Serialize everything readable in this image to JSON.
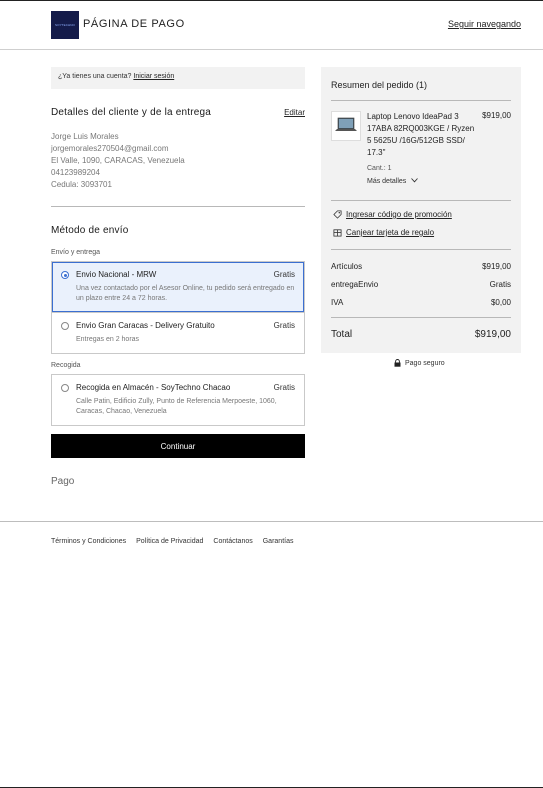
{
  "header": {
    "logo_text": "SOYTECHNO",
    "title": "PÁGINA DE PAGO",
    "continue_shopping": "Seguir navegando"
  },
  "login": {
    "question": "¿Ya tienes una cuenta?",
    "link": "Iniciar sesión"
  },
  "customer": {
    "title": "Detalles del cliente y de la entrega",
    "edit": "Editar",
    "name": "Jorge Luis Morales",
    "email": "jorgemorales270504@gmail.com",
    "address": "El Valle, 1090, CARACAS, Venezuela",
    "phone": "04123989204",
    "cedula": "Cedula: 3093701"
  },
  "shipping": {
    "title": "Método de envío",
    "delivery_label": "Envío y entrega",
    "options": [
      {
        "name": "Envio Nacional - MRW",
        "price": "Gratis",
        "desc": "Una vez contactado por el Asesor Online, tu pedido será entregado en un plazo entre 24 a 72 horas.",
        "selected": true
      },
      {
        "name": "Envio Gran Caracas - Delivery Gratuito",
        "price": "Gratis",
        "desc": "Entregas en 2 horas",
        "selected": false
      }
    ],
    "pickup_label": "Recogida",
    "pickup": {
      "name": "Recogida en Almacén - SoyTechno Chacao",
      "price": "Gratis",
      "desc": "Calle Patin, Edificio Zully, Punto de Referencia Merpoeste, 1060, Caracas, Chacao, Venezuela"
    }
  },
  "actions": {
    "continue": "Continuar"
  },
  "payment": {
    "title": "Pago"
  },
  "summary": {
    "title": "Resumen del pedido (1)",
    "product": {
      "name": "Laptop Lenovo IdeaPad 3 17ABA 82RQ003KGE / Ryzen 5 5625U /16G/512GB SSD/ 17.3\"",
      "price": "$919,00",
      "qty": "Cant.: 1",
      "more": "Más detalles"
    },
    "promo": "Ingresar código de promoción",
    "gift": "Canjear tarjeta de regalo",
    "rows": [
      {
        "label": "Artículos",
        "value": "$919,00"
      },
      {
        "label": "entregaEnvio",
        "value": "Gratis"
      },
      {
        "label": "IVA",
        "value": "$0,00"
      }
    ],
    "total_label": "Total",
    "total_value": "$919,00",
    "secure": "Pago seguro"
  },
  "footer": {
    "links": [
      "Términos y Condiciones",
      "Política de Privacidad",
      "Contáctanos",
      "Garantías"
    ]
  }
}
